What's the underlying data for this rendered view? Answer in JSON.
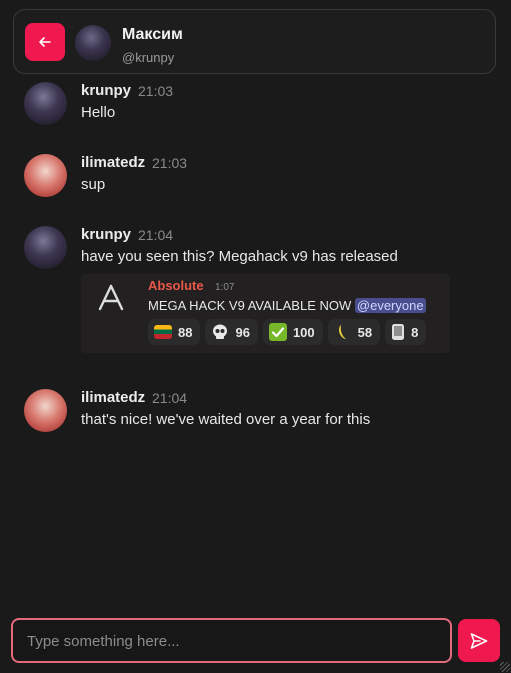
{
  "header": {
    "back_icon": "arrow-left-icon",
    "name": "Максим",
    "handle": "@krunpy"
  },
  "messages": [
    {
      "author": "krunpy",
      "time": "21:03",
      "text": "Hello"
    },
    {
      "author": "ilimatedz",
      "time": "21:03",
      "text": "sup"
    },
    {
      "author": "krunpy",
      "time": "21:04",
      "text": "have you seen this? Megahack v9 has released"
    },
    {
      "author": "ilimatedz",
      "time": "21:04",
      "text": "that's nice! we've waited over a year for this"
    }
  ],
  "embed": {
    "author": "Absolute",
    "time": "1:07",
    "text": "MEGA HACK V9 AVAILABLE NOW",
    "mention": "@everyone",
    "reactions": [
      {
        "icon": "lithuania-flag-icon",
        "count": "88"
      },
      {
        "icon": "skull-icon",
        "count": "96"
      },
      {
        "icon": "check-mark-icon",
        "count": "100"
      },
      {
        "icon": "banana-icon",
        "count": "58"
      },
      {
        "icon": "phone-icon",
        "count": "8"
      }
    ]
  },
  "composer": {
    "placeholder": "Type something here...",
    "send_icon": "send-icon"
  },
  "colors": {
    "accent": "#f0194f",
    "background": "#1a1a1a"
  }
}
